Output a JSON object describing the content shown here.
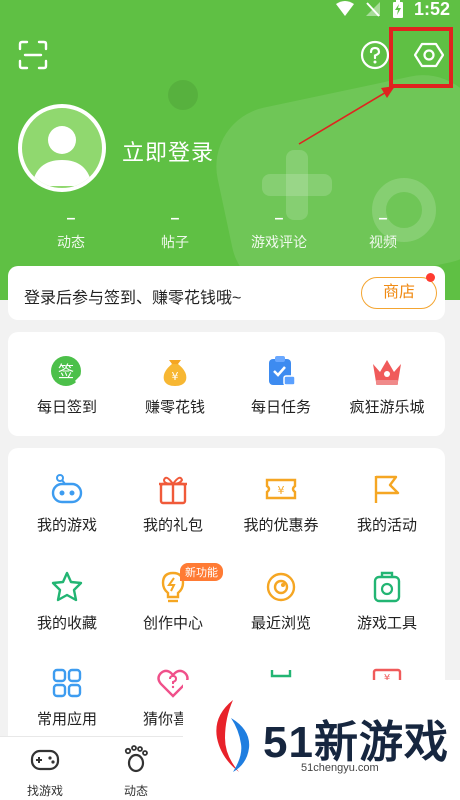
{
  "status": {
    "time": "1:52"
  },
  "profile": {
    "login_label": "立即登录"
  },
  "stats": [
    {
      "value": "–",
      "label": "动态"
    },
    {
      "value": "–",
      "label": "帖子"
    },
    {
      "value": "–",
      "label": "游戏评论"
    },
    {
      "value": "–",
      "label": "视频"
    }
  ],
  "signin": {
    "text": "登录后参与签到、赚零花钱哦~",
    "shop_label": "商店"
  },
  "quick_actions": [
    {
      "label": "每日签到",
      "icon": "sign-in-badge-icon",
      "badge_text": "签"
    },
    {
      "label": "赚零花钱",
      "icon": "money-bag-icon",
      "badge_text": "¥"
    },
    {
      "label": "每日任务",
      "icon": "task-clipboard-icon"
    },
    {
      "label": "疯狂游乐城",
      "icon": "crown-icon"
    }
  ],
  "menu": [
    {
      "label": "我的游戏",
      "icon": "gamepad-icon"
    },
    {
      "label": "我的礼包",
      "icon": "gift-icon"
    },
    {
      "label": "我的优惠券",
      "icon": "coupon-icon",
      "badge_text": "¥"
    },
    {
      "label": "我的活动",
      "icon": "flag-icon"
    },
    {
      "label": "我的收藏",
      "icon": "star-icon"
    },
    {
      "label": "创作中心",
      "icon": "lightbulb-icon",
      "tag": "新功能"
    },
    {
      "label": "最近浏览",
      "icon": "eye-icon"
    },
    {
      "label": "游戏工具",
      "icon": "toolbox-icon"
    },
    {
      "label": "常用应用",
      "icon": "apps-grid-icon"
    },
    {
      "label": "猜你喜欢",
      "icon": "heart-question-icon"
    }
  ],
  "bottom_nav": [
    {
      "label": "找游戏",
      "icon": "gamepad-icon"
    },
    {
      "label": "动态",
      "icon": "footprint-icon"
    }
  ],
  "watermark": {
    "title": "51新游戏",
    "url": "51chengyu.com"
  },
  "colors": {
    "header_green": "#5fc044",
    "highlight_red": "#e0231f",
    "accent_orange": "#f08a13"
  }
}
